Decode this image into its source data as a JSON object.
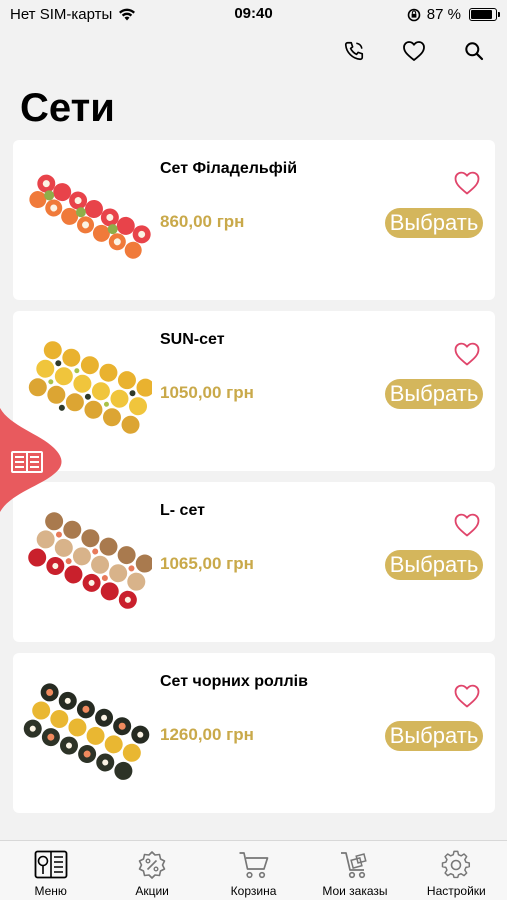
{
  "status_bar": {
    "carrier": "Нет SIM-карты",
    "time": "09:40",
    "battery_percent": "87 %",
    "battery_level": 0.87
  },
  "header": {
    "title": "Сети",
    "actions": [
      {
        "icon": "phone-icon"
      },
      {
        "icon": "heart-icon"
      },
      {
        "icon": "search-icon"
      }
    ]
  },
  "colors": {
    "accent": "#d4b65c",
    "price": "#c9a94a",
    "favorite": "#e0456b",
    "float_tab": "#e85a5e"
  },
  "products": [
    {
      "name": "Сет Філадельфій",
      "price": "860,00 грн",
      "button": "Выбрать",
      "image": "sushi-set-philadelphia"
    },
    {
      "name": "SUN-сет",
      "price": "1050,00 грн",
      "button": "Выбрать",
      "image": "sushi-set-sun"
    },
    {
      "name": "L- сет",
      "price": "1065,00 грн",
      "button": "Выбрать",
      "image": "sushi-set-l"
    },
    {
      "name": "Сет чорних роллів",
      "price": "1260,00 грн",
      "button": "Выбрать",
      "image": "sushi-set-black"
    }
  ],
  "tabs": [
    {
      "label": "Меню",
      "icon": "menu-book-icon",
      "active": true
    },
    {
      "label": "Акции",
      "icon": "discount-icon",
      "active": false
    },
    {
      "label": "Корзина",
      "icon": "cart-icon",
      "active": false
    },
    {
      "label": "Мои заказы",
      "icon": "orders-cart-icon",
      "active": false
    },
    {
      "label": "Настройки",
      "icon": "gear-icon",
      "active": false
    }
  ]
}
